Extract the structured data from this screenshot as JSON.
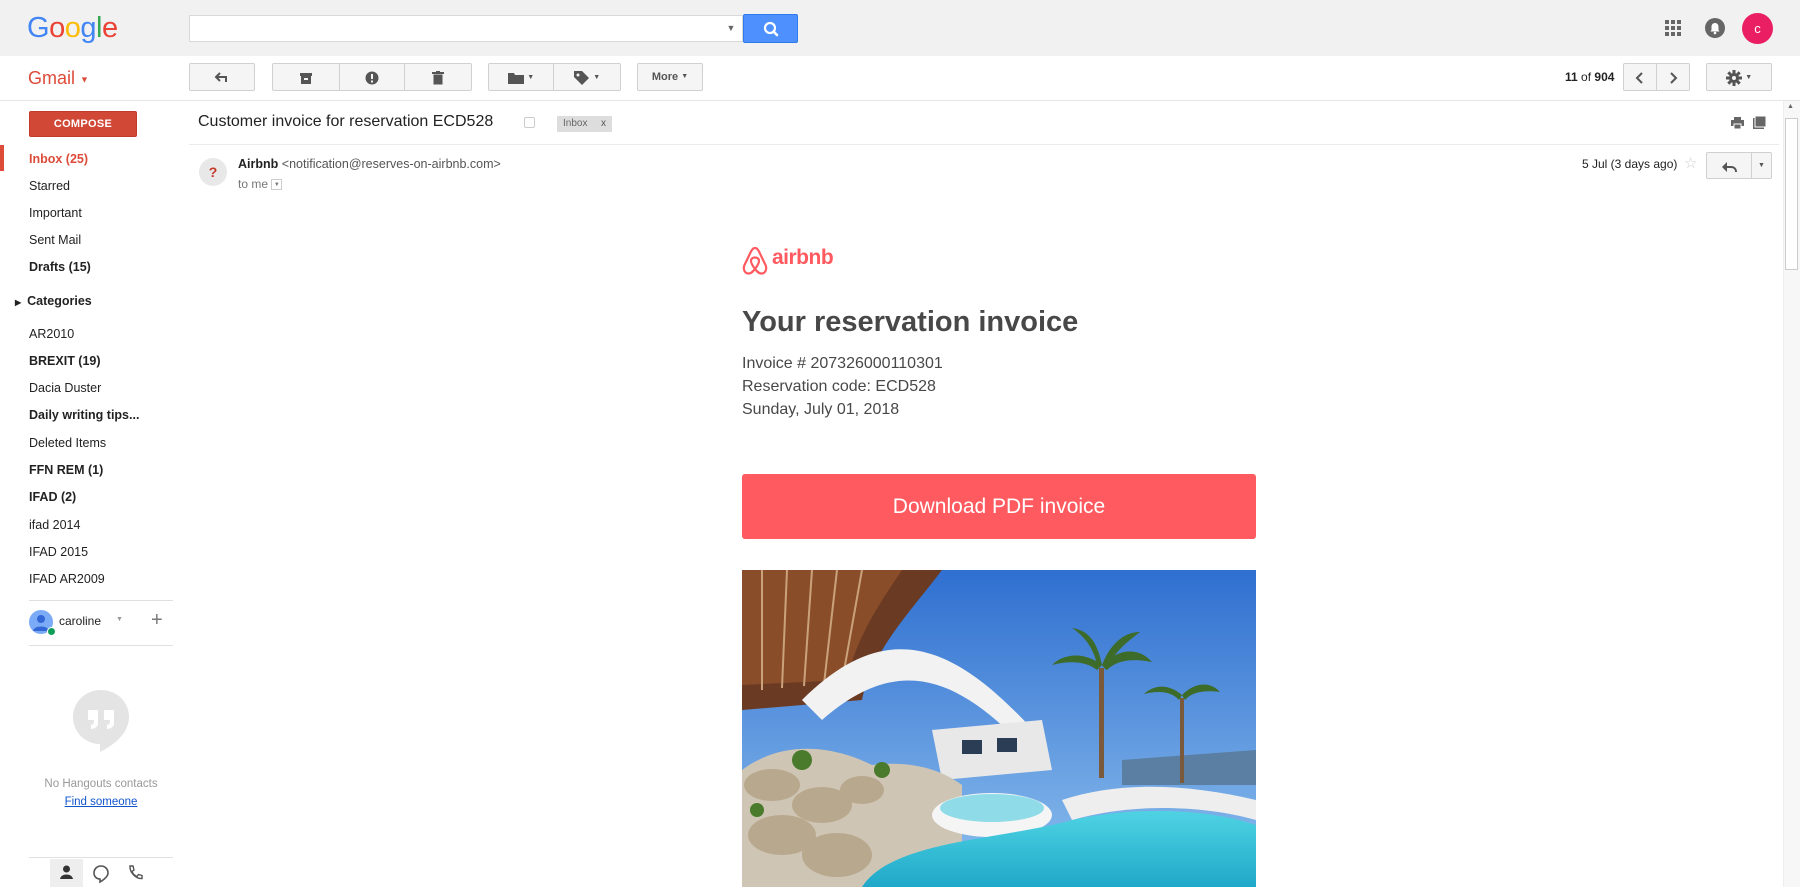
{
  "header": {
    "logo": "Google",
    "avatar_letter": "c"
  },
  "app": {
    "label": "Gmail"
  },
  "toolbar": {
    "more_label": "More",
    "count_current": "11",
    "count_of": "of",
    "count_total": "904"
  },
  "sidebar": {
    "compose_label": "COMPOSE",
    "items": [
      {
        "label": "Inbox (25)"
      },
      {
        "label": "Starred"
      },
      {
        "label": "Important"
      },
      {
        "label": "Sent Mail"
      },
      {
        "label": "Drafts (15)"
      }
    ],
    "categories_label": "Categories",
    "labels": [
      {
        "label": "AR2010"
      },
      {
        "label": "BREXIT (19)"
      },
      {
        "label": "Dacia Duster"
      },
      {
        "label": "Daily writing tips..."
      },
      {
        "label": "Deleted Items"
      },
      {
        "label": "FFN REM (1)"
      },
      {
        "label": "IFAD (2)"
      },
      {
        "label": "ifad 2014"
      },
      {
        "label": "IFAD 2015"
      },
      {
        "label": "IFAD AR2009"
      }
    ],
    "user_name": "caroline",
    "hangouts_empty": "No Hangouts contacts",
    "find_someone": "Find someone"
  },
  "message": {
    "subject": "Customer invoice for reservation ECD528",
    "chip_label": "Inbox",
    "chip_close": "x",
    "sender_avatar": "?",
    "sender_name": "Airbnb",
    "sender_email": "<notification@reserves-on-airbnb.com>",
    "to_line": "to me",
    "date": "5 Jul (3 days ago)"
  },
  "email_body": {
    "brand": "airbnb",
    "heading": "Your reservation invoice",
    "invoice_line": "Invoice # 207326000110301",
    "reservation_line": "Reservation code: ECD528",
    "date_line": "Sunday, July 01, 2018",
    "download_label": "Download PDF invoice"
  },
  "colors": {
    "google_blue": "#4285f4",
    "google_red": "#ea4335",
    "google_yellow": "#fbbc05",
    "google_green": "#34a853",
    "gmail_red": "#dd4b39",
    "airbnb_coral": "#ff5a5f"
  }
}
